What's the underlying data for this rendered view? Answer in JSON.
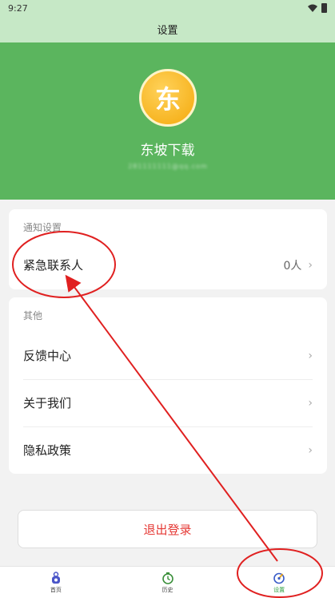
{
  "status_bar": {
    "time": "9:27"
  },
  "header": {
    "title": "设置"
  },
  "profile": {
    "avatar_char": "东",
    "username": "东坡下载",
    "email": "281111111@qq.com"
  },
  "notify_section": {
    "title": "通知设置",
    "items": [
      {
        "label": "紧急联系人",
        "value": "0人"
      }
    ]
  },
  "other_section": {
    "title": "其他",
    "items": [
      {
        "label": "反馈中心"
      },
      {
        "label": "关于我们"
      },
      {
        "label": "隐私政策"
      }
    ]
  },
  "logout": {
    "label": "退出登录"
  },
  "bottom_nav": {
    "items": [
      {
        "label": "首页",
        "icon": "home-icon"
      },
      {
        "label": "历史",
        "icon": "history-icon"
      },
      {
        "label": "设置",
        "icon": "settings-icon",
        "active": true
      }
    ]
  },
  "colors": {
    "header_bg": "#c6e8c6",
    "profile_bg": "#5bb55e",
    "accent": "#2e9e3f",
    "logout_text": "#e53935",
    "annotation": "#e02020"
  },
  "chevron_glyph": "›"
}
